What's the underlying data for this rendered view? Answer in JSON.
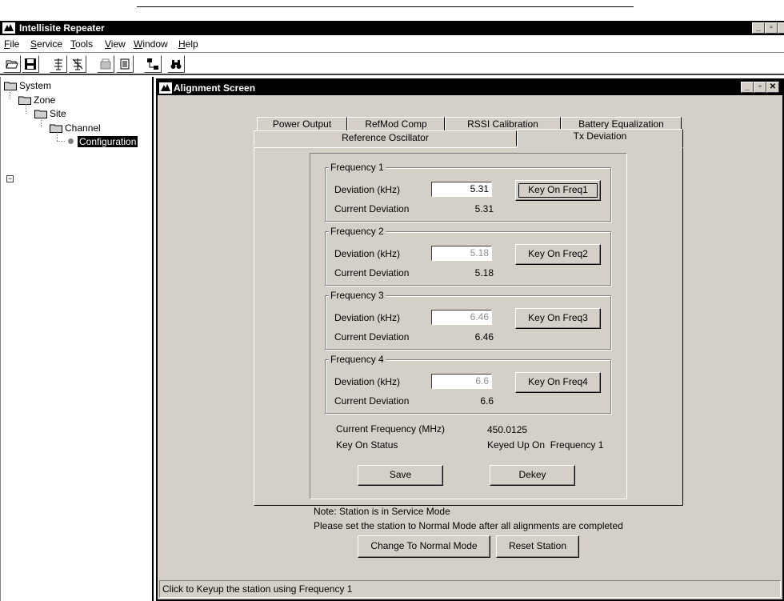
{
  "app": {
    "title": "Intellisite Repeater"
  },
  "menu": [
    {
      "label": "File",
      "u": "F",
      "rest": "ile"
    },
    {
      "label": "Service",
      "u": "S",
      "rest": "ervice"
    },
    {
      "label": "Tools",
      "u": "T",
      "rest": "ools"
    },
    {
      "label": "View",
      "u": "V",
      "rest": "iew"
    },
    {
      "label": "Window",
      "u": "W",
      "rest": "indow"
    },
    {
      "label": "Help",
      "u": "H",
      "rest": "elp"
    }
  ],
  "toolbar": {
    "icons": [
      "open-folder-icon",
      "save-disk-icon",
      "tower-connect-icon",
      "tower-disconnect-icon",
      "station-icon",
      "document-icon",
      "network-icon",
      "binoculars-icon"
    ]
  },
  "tree": {
    "system": "System",
    "zone": "Zone",
    "site": "Site",
    "channel": "Channel",
    "configuration": "Configuration"
  },
  "alignment": {
    "title": "Alignment Screen",
    "tabs_back": [
      "Power Output",
      "RefMod Comp",
      "RSSI Calibration",
      "Battery Equalization"
    ],
    "tabs_front": [
      "Reference Oscillator",
      "Tx Deviation"
    ],
    "active_tab": "Tx Deviation",
    "deviation_label": "Deviation (kHz)",
    "current_label": "Current Deviation",
    "frequencies": [
      {
        "legend": "Frequency 1",
        "deviation": "5.31",
        "current": "5.31",
        "button": "Key On Freq1",
        "dim": false
      },
      {
        "legend": "Frequency 2",
        "deviation": "5.18",
        "current": "5.18",
        "button": "Key On Freq2",
        "dim": true
      },
      {
        "legend": "Frequency 3",
        "deviation": "6.46",
        "current": "6.46",
        "button": "Key On Freq3",
        "dim": true
      },
      {
        "legend": "Frequency 4",
        "deviation": "6.6",
        "current": "6.6",
        "button": "Key On Freq4",
        "dim": true
      }
    ],
    "current_frequency_label": "Current Frequency (MHz)",
    "current_frequency_value": "450.0125",
    "key_on_status_label": "Key On Status",
    "key_on_status_value": "Keyed Up On  Frequency 1",
    "save_button": "Save",
    "dekey_button": "Dekey",
    "note_line1": "Note: Station is in Service Mode",
    "note_line2": "Please set the station to Normal Mode after all alignments are completed",
    "normal_mode_button": "Change To Normal Mode",
    "reset_button": "Reset Station",
    "status": "Click to Keyup the station using Frequency 1"
  },
  "window_controls": {
    "minimize": "_",
    "restore": "▫",
    "close": "✕"
  }
}
